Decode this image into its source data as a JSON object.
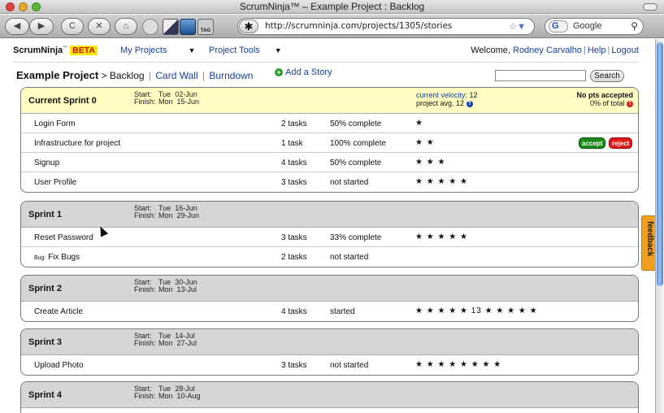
{
  "window": {
    "title": "ScrumNinja™ – Example Project : Backlog"
  },
  "browser": {
    "back_label": "◀",
    "forward_label": "▶",
    "reload_label": "C",
    "stop_label": "✕",
    "home_label": "⌂",
    "tag_label": "TAG",
    "url": "http://scrumninja.com/projects/1305/stories",
    "url_star": "☆▼",
    "search_engine_label": "G",
    "search_placeholder": "Google",
    "search_icon_glyph": "🔍"
  },
  "topnav": {
    "brand": "ScrumNinja",
    "brand_tm": "™",
    "beta": "BETA",
    "my_projects": "My Projects",
    "project_tools": "Project Tools",
    "caret": "▼",
    "welcome_prefix": "Welcome,",
    "user_name": "Rodney Carvalho",
    "help": "Help",
    "logout": "Logout",
    "separator": "|"
  },
  "breadcrumb": {
    "project": "Example Project",
    "arrow": ">",
    "backlog": "Backlog",
    "card_wall": "Card Wall",
    "burndown": "Burndown",
    "sep": "|"
  },
  "actions": {
    "add_story": "Add a Story",
    "search_button": "Search",
    "search_value": ""
  },
  "labels": {
    "start": "Start:",
    "finish": "Finish:",
    "current_velocity": "current velocity:",
    "project_avg": "project avg.",
    "no_pts_accepted": "No pts accepted",
    "pct_of_total": "0% of total",
    "accept": "accept",
    "reject": "reject",
    "feedback": "feedback"
  },
  "sprints": [
    {
      "name": "Current Sprint 0",
      "start_dow": "Tue",
      "start_date": "02-Jun",
      "finish_dow": "Mon",
      "finish_date": "15-Jun",
      "current_velocity": "12",
      "project_avg": "12",
      "stories": [
        {
          "title": "Login Form",
          "tasks": "2 tasks",
          "status": "50% complete",
          "stars": "★"
        },
        {
          "title": "Infrastructure for project",
          "tasks": "1 task",
          "status": "100% complete",
          "stars": "★ ★"
        },
        {
          "title": "Signup",
          "tasks": "4 tasks",
          "status": "50% complete",
          "stars": "★ ★ ★"
        },
        {
          "title": "User Profile",
          "tasks": "3 tasks",
          "status": "not started",
          "stars": "★ ★ ★ ★ ★"
        }
      ]
    },
    {
      "name": "Sprint 1",
      "start_dow": "Tue",
      "start_date": "16-Jun",
      "finish_dow": "Mon",
      "finish_date": "29-Jun",
      "stories": [
        {
          "title": "Reset Password",
          "tasks": "3 tasks",
          "status": "33% complete",
          "stars": "★ ★ ★ ★ ★"
        },
        {
          "bug_prefix": "Bug:",
          "title": "Fix Bugs",
          "tasks": "2 tasks",
          "status": "not started",
          "stars": ""
        }
      ]
    },
    {
      "name": "Sprint 2",
      "start_dow": "Tue",
      "start_date": "30-Jun",
      "finish_dow": "Mon",
      "finish_date": "13-Jul",
      "stories": [
        {
          "title": "Create Article",
          "tasks": "4 tasks",
          "status": "started",
          "stars": "★ ★ ★ ★ ★ 13 ★ ★ ★ ★ ★"
        }
      ]
    },
    {
      "name": "Sprint 3",
      "start_dow": "Tue",
      "start_date": "14-Jul",
      "finish_dow": "Mon",
      "finish_date": "27-Jul",
      "stories": [
        {
          "title": "Upload Photo",
          "tasks": "3 tasks",
          "status": "not started",
          "stars": "★ ★ ★ ★ ★ ★ ★ ★"
        }
      ]
    },
    {
      "name": "Sprint 4",
      "start_dow": "Tue",
      "start_date": "28-Jul",
      "finish_dow": "Mon",
      "finish_date": "10-Aug",
      "stories": []
    }
  ]
}
